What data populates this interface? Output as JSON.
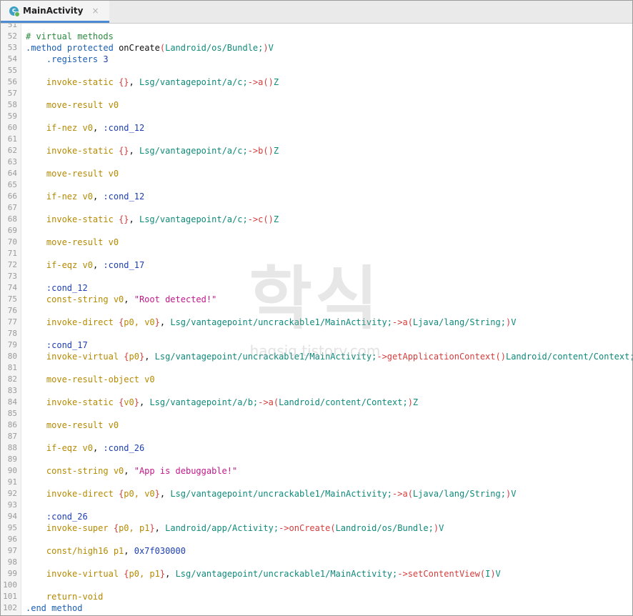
{
  "tab": {
    "icon": "class-file-icon",
    "title": "MainActivity",
    "close": "×"
  },
  "watermark": {
    "text": "학식",
    "subtext": "hagsig.tistory.com"
  },
  "lines": [
    {
      "n": "51",
      "tokens": []
    },
    {
      "n": "52",
      "tokens": [
        [
          "comment",
          "# virtual methods"
        ]
      ]
    },
    {
      "n": "53",
      "tokens": [
        [
          "directive",
          ".method"
        ],
        [
          "plain",
          " "
        ],
        [
          "keyword",
          "protected"
        ],
        [
          "plain",
          " onCreate"
        ],
        [
          "brace",
          "("
        ],
        [
          "type",
          "Landroid/os/Bundle;"
        ],
        [
          "brace",
          ")"
        ],
        [
          "type",
          "V"
        ]
      ]
    },
    {
      "n": "54",
      "tokens": [
        [
          "plain",
          "    "
        ],
        [
          "directive",
          ".registers"
        ],
        [
          "plain",
          " "
        ],
        [
          "hex",
          "3"
        ]
      ]
    },
    {
      "n": "55",
      "tokens": []
    },
    {
      "n": "56",
      "tokens": [
        [
          "plain",
          "    "
        ],
        [
          "op",
          "invoke-static"
        ],
        [
          "plain",
          " "
        ],
        [
          "brace",
          "{}"
        ],
        [
          "plain",
          ", "
        ],
        [
          "type",
          "Lsg/vantagepoint/a/c;"
        ],
        [
          "brace",
          "->a()"
        ],
        [
          "type",
          "Z"
        ]
      ]
    },
    {
      "n": "57",
      "tokens": []
    },
    {
      "n": "58",
      "tokens": [
        [
          "plain",
          "    "
        ],
        [
          "op",
          "move-result v0"
        ]
      ]
    },
    {
      "n": "59",
      "tokens": []
    },
    {
      "n": "60",
      "tokens": [
        [
          "plain",
          "    "
        ],
        [
          "op",
          "if-nez v0"
        ],
        [
          "plain",
          ", "
        ],
        [
          "label",
          ":cond_12"
        ]
      ]
    },
    {
      "n": "61",
      "tokens": []
    },
    {
      "n": "62",
      "tokens": [
        [
          "plain",
          "    "
        ],
        [
          "op",
          "invoke-static"
        ],
        [
          "plain",
          " "
        ],
        [
          "brace",
          "{}"
        ],
        [
          "plain",
          ", "
        ],
        [
          "type",
          "Lsg/vantagepoint/a/c;"
        ],
        [
          "brace",
          "->b()"
        ],
        [
          "type",
          "Z"
        ]
      ]
    },
    {
      "n": "63",
      "tokens": []
    },
    {
      "n": "64",
      "tokens": [
        [
          "plain",
          "    "
        ],
        [
          "op",
          "move-result v0"
        ]
      ]
    },
    {
      "n": "65",
      "tokens": []
    },
    {
      "n": "66",
      "tokens": [
        [
          "plain",
          "    "
        ],
        [
          "op",
          "if-nez v0"
        ],
        [
          "plain",
          ", "
        ],
        [
          "label",
          ":cond_12"
        ]
      ]
    },
    {
      "n": "67",
      "tokens": []
    },
    {
      "n": "68",
      "tokens": [
        [
          "plain",
          "    "
        ],
        [
          "op",
          "invoke-static"
        ],
        [
          "plain",
          " "
        ],
        [
          "brace",
          "{}"
        ],
        [
          "plain",
          ", "
        ],
        [
          "type",
          "Lsg/vantagepoint/a/c;"
        ],
        [
          "brace",
          "->c()"
        ],
        [
          "type",
          "Z"
        ]
      ]
    },
    {
      "n": "69",
      "tokens": []
    },
    {
      "n": "70",
      "tokens": [
        [
          "plain",
          "    "
        ],
        [
          "op",
          "move-result v0"
        ]
      ]
    },
    {
      "n": "71",
      "tokens": []
    },
    {
      "n": "72",
      "tokens": [
        [
          "plain",
          "    "
        ],
        [
          "op",
          "if-eqz v0"
        ],
        [
          "plain",
          ", "
        ],
        [
          "label",
          ":cond_17"
        ]
      ]
    },
    {
      "n": "73",
      "tokens": []
    },
    {
      "n": "74",
      "tokens": [
        [
          "plain",
          "    "
        ],
        [
          "label",
          ":cond_12"
        ]
      ]
    },
    {
      "n": "75",
      "tokens": [
        [
          "plain",
          "    "
        ],
        [
          "op",
          "const-string v0"
        ],
        [
          "plain",
          ", "
        ],
        [
          "string",
          "\"Root detected!\""
        ]
      ]
    },
    {
      "n": "76",
      "tokens": []
    },
    {
      "n": "77",
      "tokens": [
        [
          "plain",
          "    "
        ],
        [
          "op",
          "invoke-direct"
        ],
        [
          "plain",
          " "
        ],
        [
          "brace",
          "{"
        ],
        [
          "op",
          "p0, v0"
        ],
        [
          "brace",
          "}"
        ],
        [
          "plain",
          ", "
        ],
        [
          "type",
          "Lsg/vantagepoint/uncrackable1/MainActivity;"
        ],
        [
          "brace",
          "->a("
        ],
        [
          "type",
          "Ljava/lang/String;"
        ],
        [
          "brace",
          ")"
        ],
        [
          "type",
          "V"
        ]
      ]
    },
    {
      "n": "78",
      "tokens": []
    },
    {
      "n": "79",
      "tokens": [
        [
          "plain",
          "    "
        ],
        [
          "label",
          ":cond_17"
        ]
      ]
    },
    {
      "n": "80",
      "tokens": [
        [
          "plain",
          "    "
        ],
        [
          "op",
          "invoke-virtual"
        ],
        [
          "plain",
          " "
        ],
        [
          "brace",
          "{"
        ],
        [
          "op",
          "p0"
        ],
        [
          "brace",
          "}"
        ],
        [
          "plain",
          ", "
        ],
        [
          "type",
          "Lsg/vantagepoint/uncrackable1/MainActivity;"
        ],
        [
          "brace",
          "->getApplicationContext()"
        ],
        [
          "type",
          "Landroid/content/Context;"
        ]
      ]
    },
    {
      "n": "81",
      "tokens": []
    },
    {
      "n": "82",
      "tokens": [
        [
          "plain",
          "    "
        ],
        [
          "op",
          "move-result-object v0"
        ]
      ]
    },
    {
      "n": "83",
      "tokens": []
    },
    {
      "n": "84",
      "tokens": [
        [
          "plain",
          "    "
        ],
        [
          "op",
          "invoke-static"
        ],
        [
          "plain",
          " "
        ],
        [
          "brace",
          "{"
        ],
        [
          "op",
          "v0"
        ],
        [
          "brace",
          "}"
        ],
        [
          "plain",
          ", "
        ],
        [
          "type",
          "Lsg/vantagepoint/a/b;"
        ],
        [
          "brace",
          "->a("
        ],
        [
          "type",
          "Landroid/content/Context;"
        ],
        [
          "brace",
          ")"
        ],
        [
          "type",
          "Z"
        ]
      ]
    },
    {
      "n": "85",
      "tokens": []
    },
    {
      "n": "86",
      "tokens": [
        [
          "plain",
          "    "
        ],
        [
          "op",
          "move-result v0"
        ]
      ]
    },
    {
      "n": "87",
      "tokens": []
    },
    {
      "n": "88",
      "tokens": [
        [
          "plain",
          "    "
        ],
        [
          "op",
          "if-eqz v0"
        ],
        [
          "plain",
          ", "
        ],
        [
          "label",
          ":cond_26"
        ]
      ]
    },
    {
      "n": "89",
      "tokens": []
    },
    {
      "n": "90",
      "tokens": [
        [
          "plain",
          "    "
        ],
        [
          "op",
          "const-string v0"
        ],
        [
          "plain",
          ", "
        ],
        [
          "string",
          "\"App is debuggable!\""
        ]
      ]
    },
    {
      "n": "91",
      "tokens": []
    },
    {
      "n": "92",
      "tokens": [
        [
          "plain",
          "    "
        ],
        [
          "op",
          "invoke-direct"
        ],
        [
          "plain",
          " "
        ],
        [
          "brace",
          "{"
        ],
        [
          "op",
          "p0, v0"
        ],
        [
          "brace",
          "}"
        ],
        [
          "plain",
          ", "
        ],
        [
          "type",
          "Lsg/vantagepoint/uncrackable1/MainActivity;"
        ],
        [
          "brace",
          "->a("
        ],
        [
          "type",
          "Ljava/lang/String;"
        ],
        [
          "brace",
          ")"
        ],
        [
          "type",
          "V"
        ]
      ]
    },
    {
      "n": "93",
      "tokens": []
    },
    {
      "n": "94",
      "tokens": [
        [
          "plain",
          "    "
        ],
        [
          "label",
          ":cond_26"
        ]
      ]
    },
    {
      "n": "95",
      "tokens": [
        [
          "plain",
          "    "
        ],
        [
          "op",
          "invoke-super"
        ],
        [
          "plain",
          " "
        ],
        [
          "brace",
          "{"
        ],
        [
          "op",
          "p0, p1"
        ],
        [
          "brace",
          "}"
        ],
        [
          "plain",
          ", "
        ],
        [
          "type",
          "Landroid/app/Activity;"
        ],
        [
          "brace",
          "->onCreate("
        ],
        [
          "type",
          "Landroid/os/Bundle;"
        ],
        [
          "brace",
          ")"
        ],
        [
          "type",
          "V"
        ]
      ]
    },
    {
      "n": "96",
      "tokens": []
    },
    {
      "n": "97",
      "tokens": [
        [
          "plain",
          "    "
        ],
        [
          "op",
          "const/high16 p1"
        ],
        [
          "plain",
          ", "
        ],
        [
          "hex",
          "0x7f030000"
        ]
      ]
    },
    {
      "n": "98",
      "tokens": []
    },
    {
      "n": "99",
      "tokens": [
        [
          "plain",
          "    "
        ],
        [
          "op",
          "invoke-virtual"
        ],
        [
          "plain",
          " "
        ],
        [
          "brace",
          "{"
        ],
        [
          "op",
          "p0, p1"
        ],
        [
          "brace",
          "}"
        ],
        [
          "plain",
          ", "
        ],
        [
          "type",
          "Lsg/vantagepoint/uncrackable1/MainActivity;"
        ],
        [
          "brace",
          "->setContentView("
        ],
        [
          "type",
          "I"
        ],
        [
          "brace",
          ")"
        ],
        [
          "type",
          "V"
        ]
      ]
    },
    {
      "n": "100",
      "tokens": []
    },
    {
      "n": "101",
      "tokens": [
        [
          "plain",
          "    "
        ],
        [
          "op",
          "return-void"
        ]
      ]
    },
    {
      "n": "102",
      "tokens": [
        [
          "directive",
          ".end method"
        ]
      ]
    }
  ]
}
